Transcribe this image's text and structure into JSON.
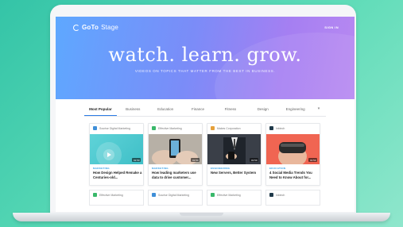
{
  "hero": {
    "logo": "GoToStage",
    "logo_bold": "GoTo",
    "logo_light": "Stage",
    "signin": "SIGN IN",
    "title": "watch. learn. grow.",
    "subtitle": "VIDEOS ON TOPICS THAT MATTER FROM THE BEST IN BUSINESS."
  },
  "tabs": [
    {
      "label": "Most Popular",
      "active": true
    },
    {
      "label": "Business"
    },
    {
      "label": "Education"
    },
    {
      "label": "Finance"
    },
    {
      "label": "Fitness"
    },
    {
      "label": "Design"
    },
    {
      "label": "Engineering"
    }
  ],
  "tab_more": "▾",
  "cards": [
    {
      "channel": "Sourise Digital Marketing",
      "duration": "01:50",
      "category": "MARKETING",
      "title": "How Design Helped Remake a Centuries-old...",
      "icon_color": "#3f8fd8"
    },
    {
      "channel": "Effective Marketing",
      "duration": "01:50",
      "category": "MARKETING",
      "title": "How leading marketers use data to drive customer...",
      "icon_color": "#39b86a"
    },
    {
      "channel": "Makes Corporation",
      "duration": "01:50",
      "category": "ENGINEERING",
      "title": "New Servers, Better System",
      "icon_color": "#e5a03a"
    },
    {
      "channel": "Inktech",
      "duration": "01:50",
      "category": "EDUCATION",
      "title": "4 Social Media Trends You Need to Know About for...",
      "icon_color": "#1f3a4a"
    }
  ],
  "cards_row2": [
    {
      "channel": "Effective Marketing",
      "icon_color": "#39b86a"
    },
    {
      "channel": "Sourise Digital Marketing",
      "icon_color": "#3f8fd8"
    },
    {
      "channel": "Effective Marketing",
      "icon_color": "#39b86a"
    },
    {
      "channel": "Inktech",
      "icon_color": "#1f3a4a"
    }
  ]
}
